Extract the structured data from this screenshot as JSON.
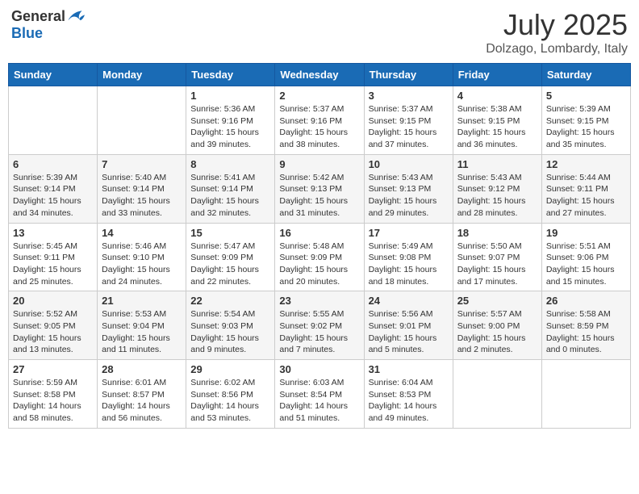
{
  "header": {
    "logo_general": "General",
    "logo_blue": "Blue",
    "month_title": "July 2025",
    "location": "Dolzago, Lombardy, Italy"
  },
  "weekdays": [
    "Sunday",
    "Monday",
    "Tuesday",
    "Wednesday",
    "Thursday",
    "Friday",
    "Saturday"
  ],
  "weeks": [
    [
      {
        "day": "",
        "sunrise": "",
        "sunset": "",
        "daylight": ""
      },
      {
        "day": "",
        "sunrise": "",
        "sunset": "",
        "daylight": ""
      },
      {
        "day": "1",
        "sunrise": "Sunrise: 5:36 AM",
        "sunset": "Sunset: 9:16 PM",
        "daylight": "Daylight: 15 hours and 39 minutes."
      },
      {
        "day": "2",
        "sunrise": "Sunrise: 5:37 AM",
        "sunset": "Sunset: 9:16 PM",
        "daylight": "Daylight: 15 hours and 38 minutes."
      },
      {
        "day": "3",
        "sunrise": "Sunrise: 5:37 AM",
        "sunset": "Sunset: 9:15 PM",
        "daylight": "Daylight: 15 hours and 37 minutes."
      },
      {
        "day": "4",
        "sunrise": "Sunrise: 5:38 AM",
        "sunset": "Sunset: 9:15 PM",
        "daylight": "Daylight: 15 hours and 36 minutes."
      },
      {
        "day": "5",
        "sunrise": "Sunrise: 5:39 AM",
        "sunset": "Sunset: 9:15 PM",
        "daylight": "Daylight: 15 hours and 35 minutes."
      }
    ],
    [
      {
        "day": "6",
        "sunrise": "Sunrise: 5:39 AM",
        "sunset": "Sunset: 9:14 PM",
        "daylight": "Daylight: 15 hours and 34 minutes."
      },
      {
        "day": "7",
        "sunrise": "Sunrise: 5:40 AM",
        "sunset": "Sunset: 9:14 PM",
        "daylight": "Daylight: 15 hours and 33 minutes."
      },
      {
        "day": "8",
        "sunrise": "Sunrise: 5:41 AM",
        "sunset": "Sunset: 9:14 PM",
        "daylight": "Daylight: 15 hours and 32 minutes."
      },
      {
        "day": "9",
        "sunrise": "Sunrise: 5:42 AM",
        "sunset": "Sunset: 9:13 PM",
        "daylight": "Daylight: 15 hours and 31 minutes."
      },
      {
        "day": "10",
        "sunrise": "Sunrise: 5:43 AM",
        "sunset": "Sunset: 9:13 PM",
        "daylight": "Daylight: 15 hours and 29 minutes."
      },
      {
        "day": "11",
        "sunrise": "Sunrise: 5:43 AM",
        "sunset": "Sunset: 9:12 PM",
        "daylight": "Daylight: 15 hours and 28 minutes."
      },
      {
        "day": "12",
        "sunrise": "Sunrise: 5:44 AM",
        "sunset": "Sunset: 9:11 PM",
        "daylight": "Daylight: 15 hours and 27 minutes."
      }
    ],
    [
      {
        "day": "13",
        "sunrise": "Sunrise: 5:45 AM",
        "sunset": "Sunset: 9:11 PM",
        "daylight": "Daylight: 15 hours and 25 minutes."
      },
      {
        "day": "14",
        "sunrise": "Sunrise: 5:46 AM",
        "sunset": "Sunset: 9:10 PM",
        "daylight": "Daylight: 15 hours and 24 minutes."
      },
      {
        "day": "15",
        "sunrise": "Sunrise: 5:47 AM",
        "sunset": "Sunset: 9:09 PM",
        "daylight": "Daylight: 15 hours and 22 minutes."
      },
      {
        "day": "16",
        "sunrise": "Sunrise: 5:48 AM",
        "sunset": "Sunset: 9:09 PM",
        "daylight": "Daylight: 15 hours and 20 minutes."
      },
      {
        "day": "17",
        "sunrise": "Sunrise: 5:49 AM",
        "sunset": "Sunset: 9:08 PM",
        "daylight": "Daylight: 15 hours and 18 minutes."
      },
      {
        "day": "18",
        "sunrise": "Sunrise: 5:50 AM",
        "sunset": "Sunset: 9:07 PM",
        "daylight": "Daylight: 15 hours and 17 minutes."
      },
      {
        "day": "19",
        "sunrise": "Sunrise: 5:51 AM",
        "sunset": "Sunset: 9:06 PM",
        "daylight": "Daylight: 15 hours and 15 minutes."
      }
    ],
    [
      {
        "day": "20",
        "sunrise": "Sunrise: 5:52 AM",
        "sunset": "Sunset: 9:05 PM",
        "daylight": "Daylight: 15 hours and 13 minutes."
      },
      {
        "day": "21",
        "sunrise": "Sunrise: 5:53 AM",
        "sunset": "Sunset: 9:04 PM",
        "daylight": "Daylight: 15 hours and 11 minutes."
      },
      {
        "day": "22",
        "sunrise": "Sunrise: 5:54 AM",
        "sunset": "Sunset: 9:03 PM",
        "daylight": "Daylight: 15 hours and 9 minutes."
      },
      {
        "day": "23",
        "sunrise": "Sunrise: 5:55 AM",
        "sunset": "Sunset: 9:02 PM",
        "daylight": "Daylight: 15 hours and 7 minutes."
      },
      {
        "day": "24",
        "sunrise": "Sunrise: 5:56 AM",
        "sunset": "Sunset: 9:01 PM",
        "daylight": "Daylight: 15 hours and 5 minutes."
      },
      {
        "day": "25",
        "sunrise": "Sunrise: 5:57 AM",
        "sunset": "Sunset: 9:00 PM",
        "daylight": "Daylight: 15 hours and 2 minutes."
      },
      {
        "day": "26",
        "sunrise": "Sunrise: 5:58 AM",
        "sunset": "Sunset: 8:59 PM",
        "daylight": "Daylight: 15 hours and 0 minutes."
      }
    ],
    [
      {
        "day": "27",
        "sunrise": "Sunrise: 5:59 AM",
        "sunset": "Sunset: 8:58 PM",
        "daylight": "Daylight: 14 hours and 58 minutes."
      },
      {
        "day": "28",
        "sunrise": "Sunrise: 6:01 AM",
        "sunset": "Sunset: 8:57 PM",
        "daylight": "Daylight: 14 hours and 56 minutes."
      },
      {
        "day": "29",
        "sunrise": "Sunrise: 6:02 AM",
        "sunset": "Sunset: 8:56 PM",
        "daylight": "Daylight: 14 hours and 53 minutes."
      },
      {
        "day": "30",
        "sunrise": "Sunrise: 6:03 AM",
        "sunset": "Sunset: 8:54 PM",
        "daylight": "Daylight: 14 hours and 51 minutes."
      },
      {
        "day": "31",
        "sunrise": "Sunrise: 6:04 AM",
        "sunset": "Sunset: 8:53 PM",
        "daylight": "Daylight: 14 hours and 49 minutes."
      },
      {
        "day": "",
        "sunrise": "",
        "sunset": "",
        "daylight": ""
      },
      {
        "day": "",
        "sunrise": "",
        "sunset": "",
        "daylight": ""
      }
    ]
  ]
}
